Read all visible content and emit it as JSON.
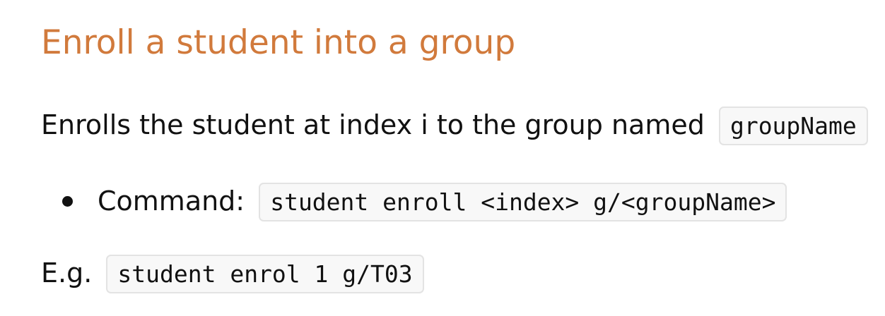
{
  "heading": "Enroll a student into a group",
  "description": {
    "text": "Enrolls the student at index i to the group named",
    "code": "groupName"
  },
  "bullets": [
    {
      "label": "Command:",
      "code": "student enroll <index> g/<groupName>"
    }
  ],
  "example": {
    "label": "E.g.",
    "code": "student enrol 1 g/T03"
  },
  "colors": {
    "heading": "#d17a3c",
    "text": "#111111",
    "code_background": "#f8f8f8",
    "code_border": "#e3e3e3"
  }
}
